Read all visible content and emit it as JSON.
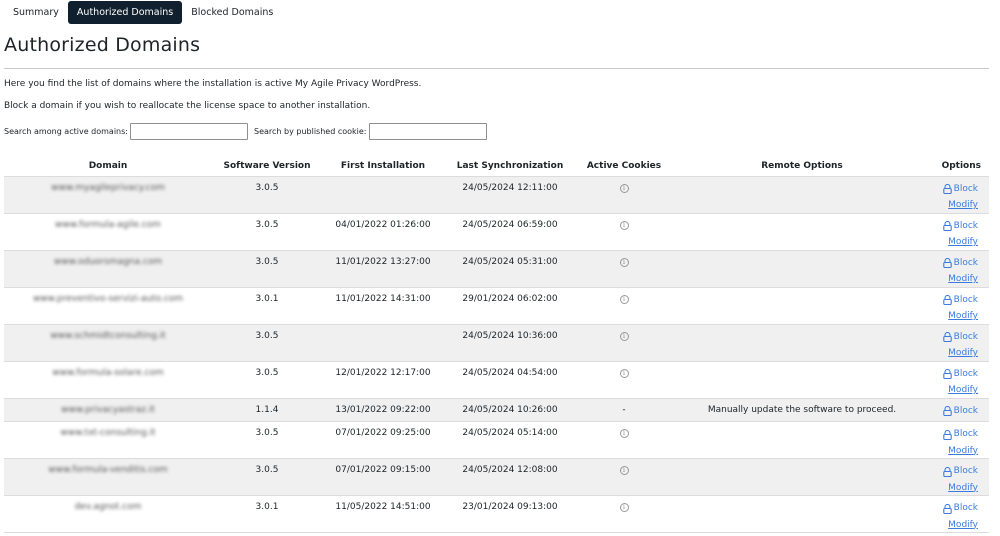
{
  "tabs": [
    {
      "label": "Summary",
      "active": false
    },
    {
      "label": "Authorized Domains",
      "active": true
    },
    {
      "label": "Blocked Domains",
      "active": false
    }
  ],
  "page_title": "Authorized Domains",
  "intro": [
    "Here you find the list of domains where the installation is active My Agile Privacy WordPress.",
    "Block a domain if you wish to reallocate the license space to another installation."
  ],
  "search": {
    "domains_label": "Search among active domains:",
    "domains_value": "",
    "cookie_label": "Search by published cookie:",
    "cookie_value": ""
  },
  "table": {
    "headers": [
      "Domain",
      "Software Version",
      "First Installation",
      "Last Synchronization",
      "Active Cookies",
      "Remote Options",
      "Options"
    ],
    "block_label": "Block",
    "modify_label": "Modify",
    "info_icon": "info-circle-icon",
    "lock_icon": "lock-icon",
    "rows": [
      {
        "domain": "www.myagileprivacy.com",
        "version": "3.0.5",
        "first_install": "",
        "last_sync": "24/05/2024 12:11:00",
        "cookies": "info",
        "remote": "",
        "modify": true
      },
      {
        "domain": "www.formula-agile.com",
        "version": "3.0.5",
        "first_install": "04/01/2022 01:26:00",
        "last_sync": "24/05/2024 06:59:00",
        "cookies": "info",
        "remote": "",
        "modify": true
      },
      {
        "domain": "www.oduorsmagna.com",
        "version": "3.0.5",
        "first_install": "11/01/2022 13:27:00",
        "last_sync": "24/05/2024 05:31:00",
        "cookies": "info",
        "remote": "",
        "modify": true
      },
      {
        "domain": "www.preventivo-servizi-auto.com",
        "version": "3.0.1",
        "first_install": "11/01/2022 14:31:00",
        "last_sync": "29/01/2024 06:02:00",
        "cookies": "info",
        "remote": "",
        "modify": true
      },
      {
        "domain": "www.schmidtconsulting.it",
        "version": "3.0.5",
        "first_install": "",
        "last_sync": "24/05/2024 10:36:00",
        "cookies": "info",
        "remote": "",
        "modify": true
      },
      {
        "domain": "www.formula-solare.com",
        "version": "3.0.5",
        "first_install": "12/01/2022 12:17:00",
        "last_sync": "24/05/2024 04:54:00",
        "cookies": "info",
        "remote": "",
        "modify": true
      },
      {
        "domain": "www.privacyastraz.it",
        "version": "1.1.4",
        "first_install": "13/01/2022 09:22:00",
        "last_sync": "24/05/2024 10:26:00",
        "cookies": "-",
        "remote": "Manually update the software to proceed.",
        "modify": false
      },
      {
        "domain": "www.txt-consulting.it",
        "version": "3.0.5",
        "first_install": "07/01/2022 09:25:00",
        "last_sync": "24/05/2024 05:14:00",
        "cookies": "info",
        "remote": "",
        "modify": true
      },
      {
        "domain": "www.formula-venditis.com",
        "version": "3.0.5",
        "first_install": "07/01/2022 09:15:00",
        "last_sync": "24/05/2024 12:08:00",
        "cookies": "info",
        "remote": "",
        "modify": true
      },
      {
        "domain": "dev.agnot.com",
        "version": "3.0.1",
        "first_install": "11/05/2022 14:51:00",
        "last_sync": "23/01/2024 09:13:00",
        "cookies": "info",
        "remote": "",
        "modify": true
      }
    ]
  }
}
